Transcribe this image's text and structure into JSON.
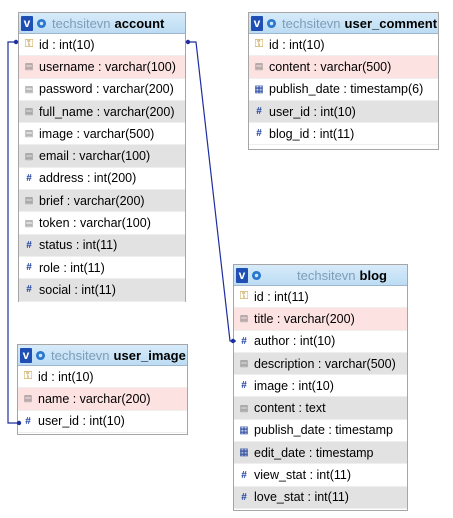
{
  "tables": [
    {
      "id": "account",
      "db": "techsitevn",
      "name": "account",
      "columns": [
        {
          "text": "id : int(10)",
          "icon": "key-icon",
          "style": "pk"
        },
        {
          "text": "username : varchar(100)",
          "icon": "text-field-icon",
          "style": "pink"
        },
        {
          "text": "password : varchar(200)",
          "icon": "text-field-icon",
          "style": "white"
        },
        {
          "text": "full_name : varchar(200)",
          "icon": "text-field-icon",
          "style": "alt"
        },
        {
          "text": "image : varchar(500)",
          "icon": "text-field-icon",
          "style": "white"
        },
        {
          "text": "email : varchar(100)",
          "icon": "text-field-icon",
          "style": "alt"
        },
        {
          "text": "address : int(200)",
          "icon": "numeric-icon",
          "style": "white"
        },
        {
          "text": "brief : varchar(200)",
          "icon": "text-field-icon",
          "style": "alt"
        },
        {
          "text": "token : varchar(100)",
          "icon": "text-field-icon",
          "style": "white"
        },
        {
          "text": "status : int(11)",
          "icon": "numeric-icon",
          "style": "alt"
        },
        {
          "text": "role : int(11)",
          "icon": "numeric-icon",
          "style": "white"
        },
        {
          "text": "social : int(11)",
          "icon": "numeric-icon",
          "style": "alt"
        }
      ]
    },
    {
      "id": "user_comment",
      "db": "techsitevn",
      "name": "user_comment",
      "columns": [
        {
          "text": "id : int(10)",
          "icon": "key-icon",
          "style": "pk"
        },
        {
          "text": "content : varchar(500)",
          "icon": "text-field-icon",
          "style": "pink"
        },
        {
          "text": "publish_date : timestamp(6)",
          "icon": "calendar-icon",
          "style": "white"
        },
        {
          "text": "user_id : int(10)",
          "icon": "numeric-icon",
          "style": "alt"
        },
        {
          "text": "blog_id : int(11)",
          "icon": "numeric-icon",
          "style": "white"
        }
      ]
    },
    {
      "id": "user_image",
      "db": "techsitevn",
      "name": "user_image",
      "columns": [
        {
          "text": "id : int(10)",
          "icon": "key-icon",
          "style": "pk"
        },
        {
          "text": "name : varchar(200)",
          "icon": "text-field-icon",
          "style": "pink"
        },
        {
          "text": "user_id : int(10)",
          "icon": "numeric-icon",
          "style": "white"
        }
      ]
    },
    {
      "id": "blog",
      "db": "techsitevn",
      "name": "blog",
      "columns": [
        {
          "text": "id : int(11)",
          "icon": "key-icon",
          "style": "pk"
        },
        {
          "text": "title : varchar(200)",
          "icon": "text-field-icon",
          "style": "pink"
        },
        {
          "text": "author : int(10)",
          "icon": "numeric-icon",
          "style": "white"
        },
        {
          "text": "description : varchar(500)",
          "icon": "text-field-icon",
          "style": "alt"
        },
        {
          "text": "image : int(10)",
          "icon": "numeric-icon",
          "style": "white"
        },
        {
          "text": "content : text",
          "icon": "text-field-icon",
          "style": "alt"
        },
        {
          "text": "publish_date : timestamp",
          "icon": "calendar-icon",
          "style": "white"
        },
        {
          "text": "edit_date : timestamp",
          "icon": "calendar-icon",
          "style": "alt"
        },
        {
          "text": "view_stat : int(11)",
          "icon": "numeric-icon",
          "style": "white"
        },
        {
          "text": "love_stat : int(11)",
          "icon": "numeric-icon",
          "style": "alt"
        }
      ]
    }
  ],
  "relations": [
    {
      "from": "account.id",
      "to": "blog.author"
    },
    {
      "from": "account.id",
      "to": "user_image.user_id"
    }
  ],
  "colors": {
    "link": "#1f2ea0",
    "header_db": "#7f9db8",
    "v_badge": "#1f4fb4"
  }
}
